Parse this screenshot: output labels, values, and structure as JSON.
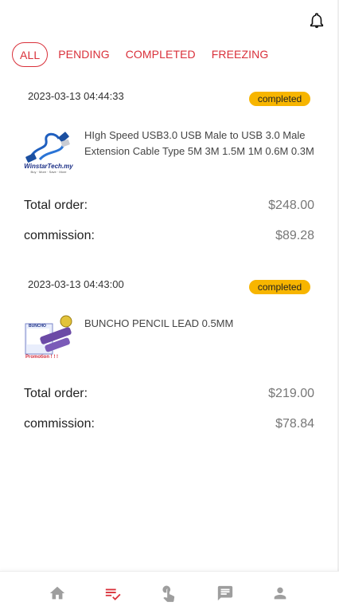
{
  "header": {
    "notifications_icon": "bell-icon"
  },
  "tabs": [
    {
      "label": "ALL",
      "active": true
    },
    {
      "label": "PENDING",
      "active": false
    },
    {
      "label": "COMPLETED",
      "active": false
    },
    {
      "label": "FREEZING",
      "active": false
    }
  ],
  "orders": [
    {
      "datetime": "2023-03-13 04:44:33",
      "status": "completed",
      "product_name": "HIgh Speed USB3.0 USB Male to USB 3.0 Male Extension Cable Type 5M 3M 1.5M 1M 0.6M 0.3M",
      "thumb_brand": "WinstarTech.my",
      "thumb_tagline": "Buy · More · Save · More",
      "total_label": "Total order:",
      "total_value": "$248.00",
      "commission_label": "commission:",
      "commission_value": "$89.28"
    },
    {
      "datetime": "2023-03-13 04:43:00",
      "status": "completed",
      "product_name": "BUNCHO PENCIL LEAD 0.5MM",
      "thumb_brand": "BUNCHO",
      "thumb_tagline": "Promotion ! ! !",
      "total_label": "Total order:",
      "total_value": "$219.00",
      "commission_label": "commission:",
      "commission_value": "$78.84"
    }
  ],
  "bottom_nav": [
    {
      "icon": "home-icon",
      "active": false
    },
    {
      "icon": "orders-checklist-icon",
      "active": true
    },
    {
      "icon": "tap-hand-icon",
      "active": false
    },
    {
      "icon": "message-icon",
      "active": false
    },
    {
      "icon": "profile-icon",
      "active": false
    }
  ],
  "colors": {
    "accent": "#d9303a",
    "badge": "#f7b500",
    "nav_inactive": "#9e9e9e"
  }
}
